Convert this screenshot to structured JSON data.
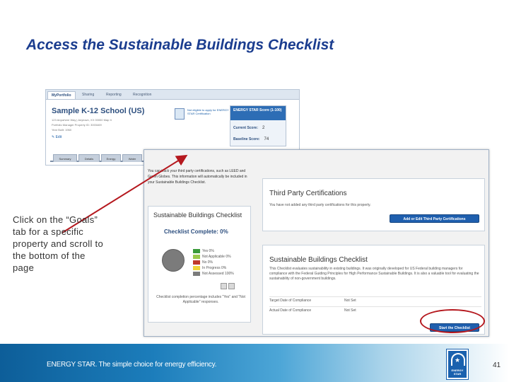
{
  "slide": {
    "title": "Access the Sustainable Buildings Checklist",
    "instruction": "Click on the “Goals” tab for a specific property and scroll to the bottom of the page",
    "page_number": "41",
    "footer_tagline": "ENERGY STAR. The simple choice for energy efficiency.",
    "logo_text": "ENERGY STAR"
  },
  "portfolio_screen": {
    "top_tabs": [
      "MyPortfolio",
      "Sharing",
      "Reporting",
      "Recognition"
    ],
    "property_name": "Sample K-12 School (US)",
    "address_line": "123 Anywhere Way | Anytown, XX 00000  Map It",
    "pm_id_line": "Portfolio Manager Property ID: 3003469",
    "year_built_line": "Year Built: 1960",
    "edit_link": "Edit",
    "cert_link": "Not eligible to apply for ENERGY STAR Certification",
    "score_header": "ENERGY STAR Score (1-100)",
    "current_score_label": "Current Score:",
    "current_score_value": "2",
    "baseline_score_label": "Baseline Score:",
    "baseline_score_value": "74",
    "bottom_tabs": [
      "Summary",
      "Details",
      "Energy",
      "Water",
      "Waste & Materials",
      "Goals",
      "Design"
    ]
  },
  "goals_screen": {
    "intro_text": "You can track your third party certifications, such as LEED and Green Globes. This information will automatically be included in your Sustainable Buildings Checklist.",
    "sbc_small_title": "Sustainable Buildings Checklist",
    "checklist_complete": "Checklist Complete: 0%",
    "legend": [
      {
        "label": "Yes 0%",
        "color": "#3a9a3a"
      },
      {
        "label": "Not Applicable 0%",
        "color": "#9ac84c"
      },
      {
        "label": "No 0%",
        "color": "#c0392b"
      },
      {
        "label": "In Progress 0%",
        "color": "#f0d43a"
      },
      {
        "label": "Not Assessed 100%",
        "color": "#7b7b7b"
      }
    ],
    "sbc_note": "Checklist completion percentage includes \"Yes\" and \"Not Applicable\" responses.",
    "tpc_title": "Third Party Certifications",
    "tpc_text": "You have not added any third party certifications for this property.",
    "tpc_button": "Add or Edit Third Party Certifications",
    "sb_title": "Sustainable Buildings Checklist",
    "sb_description": "This Checklist evaluates sustainability in existing buildings. It was originally developed for US Federal building managers for compliance with the Federal Guiding Principles for High Performance Sustainable Buildings. It is also a valuable tool for evaluating the sustainability of non-government buildings.",
    "target_date_label": "Target Date of Compliance",
    "target_date_value": "Not Set",
    "actual_date_label": "Actual Date of Compliance",
    "actual_date_value": "Not Set",
    "start_button": "Start the Checklist"
  }
}
